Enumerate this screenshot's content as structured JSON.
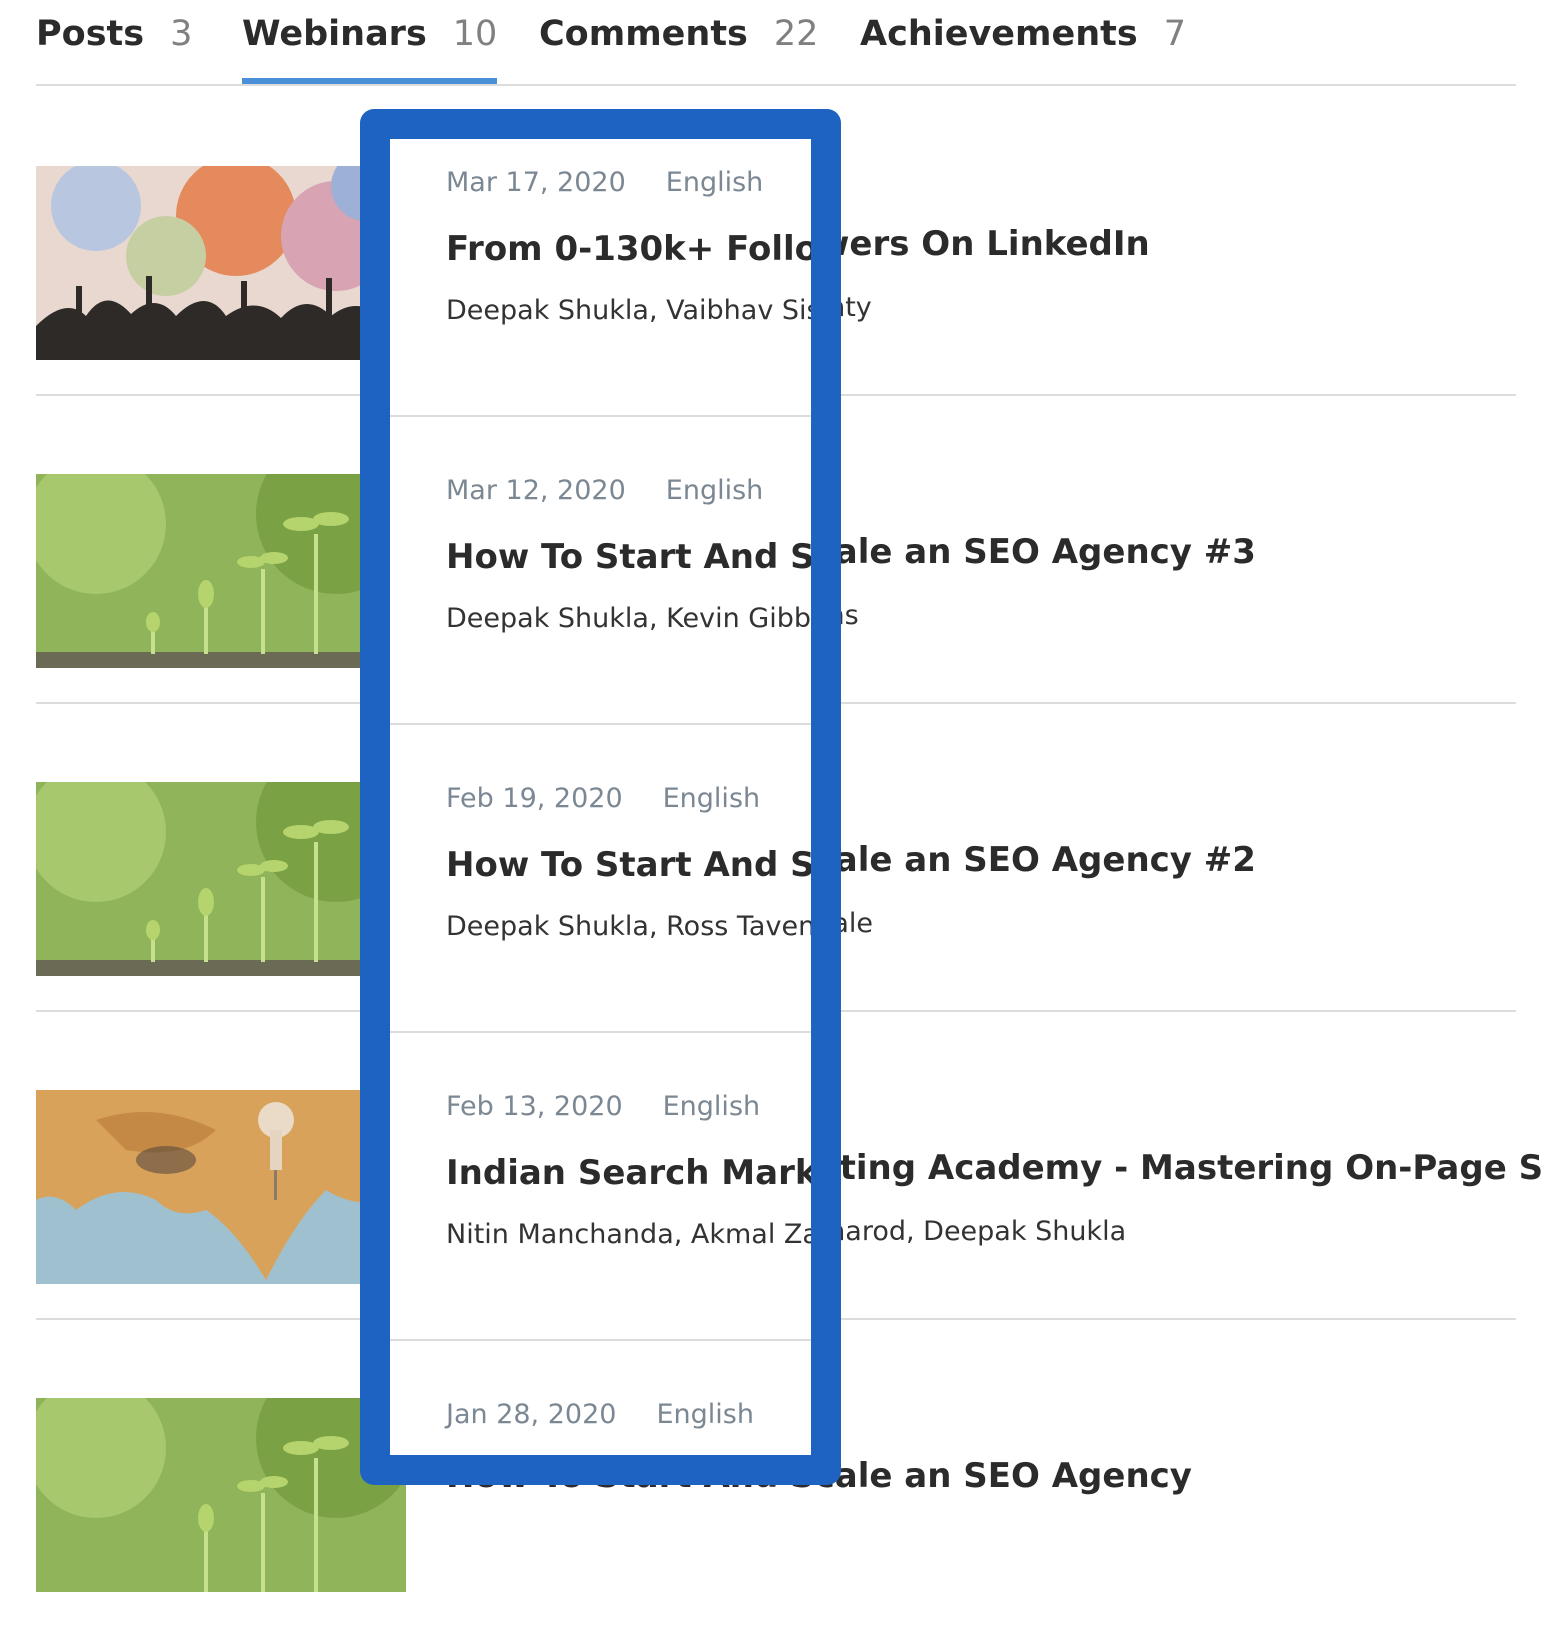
{
  "tabs": [
    {
      "label": "Posts",
      "count": "3"
    },
    {
      "label": "Webinars",
      "count": "10"
    },
    {
      "label": "Comments",
      "count": "22"
    },
    {
      "label": "Achievements",
      "count": "7"
    }
  ],
  "active_tab": "Webinars",
  "webinars": [
    {
      "date": "Mar 17, 2020",
      "language": "English",
      "title": "From 0-130k+ Followers On LinkedIn",
      "authors": "Deepak Shukla, Vaibhav Sisinty",
      "thumbnail": "crowd-with-color-powder"
    },
    {
      "date": "Mar 12, 2020",
      "language": "English",
      "title": "How To Start And Scale an SEO Agency #3",
      "authors": "Deepak Shukla, Kevin Gibbons",
      "thumbnail": "growing-seedlings"
    },
    {
      "date": "Feb 19, 2020",
      "language": "English",
      "title": "How To Start And Scale an SEO Agency #2",
      "authors": "Deepak Shukla, Ross Tavendale",
      "thumbnail": "growing-seedlings"
    },
    {
      "date": "Feb 13, 2020",
      "language": "English",
      "title": "Indian Search Marketing Academy - Mastering On-Page SEO",
      "authors": "Nitin Manchanda, Akmal Zamarod, Deepak Shukla",
      "thumbnail": "map-with-pin-on-india"
    },
    {
      "date": "Jan 28, 2020",
      "language": "English",
      "title": "How To Start And Scale an SEO Agency",
      "authors": "",
      "thumbnail": "growing-seedlings"
    }
  ],
  "colors": {
    "highlight_border": "#1f63c2",
    "active_tab_underline": "#4a90d9",
    "meta_text": "#7b8893"
  }
}
